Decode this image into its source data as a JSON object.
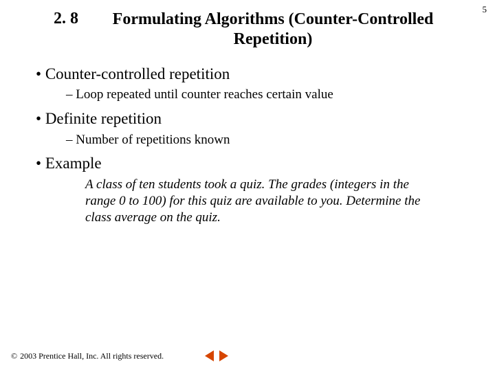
{
  "page_number": "5",
  "header": {
    "section_number": "2. 8",
    "title": "Formulating Algorithms (Counter-Controlled Repetition)"
  },
  "content": {
    "bullets": [
      {
        "text": "Counter-controlled repetition",
        "sub": [
          "Loop repeated until counter reaches certain value"
        ]
      },
      {
        "text": "Definite repetition",
        "sub": [
          "Number of repetitions known"
        ]
      },
      {
        "text": "Example",
        "example": "A class of ten students took a quiz. The grades (integers in the range 0 to 100) for this quiz are available to you. Determine the class average on the quiz."
      }
    ]
  },
  "footer": {
    "copyright_symbol": "©",
    "copyright_text": "2003 Prentice Hall, Inc. All rights reserved."
  },
  "icons": {
    "prev": "prev-slide",
    "next": "next-slide"
  }
}
